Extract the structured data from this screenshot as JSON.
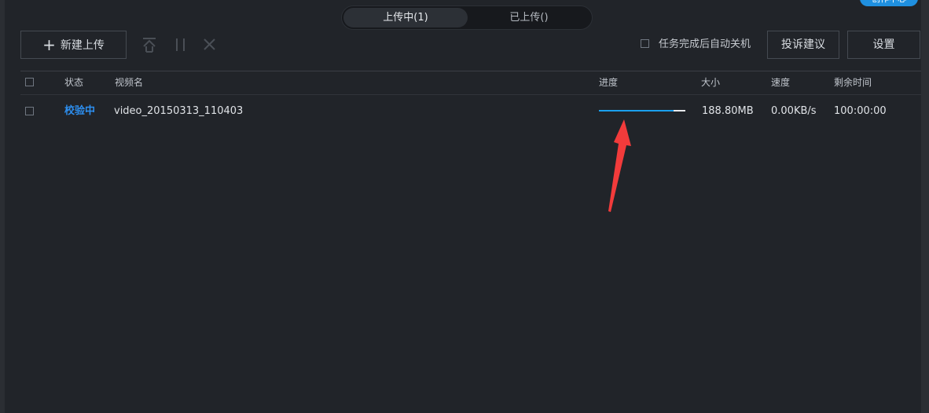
{
  "tabs": [
    {
      "label": "上传中(1)",
      "active": true
    },
    {
      "label": "已上传()",
      "active": false
    }
  ],
  "corner_badge": "创作中心",
  "toolbar": {
    "new_upload_label": "新建上传",
    "auto_shutdown_label": "任务完成后自动关机",
    "complaint_label": "投诉建议",
    "settings_label": "设置",
    "icons": [
      "move-to-top-icon",
      "pause-icon",
      "close-icon"
    ]
  },
  "table": {
    "columns": [
      "状态",
      "视频名",
      "进度",
      "大小",
      "速度",
      "剩余时间"
    ],
    "rows": [
      {
        "status": "校验中",
        "name": "video_20150313_110403",
        "progress": 0.86,
        "size": "188.80MB",
        "speed": "0.00KB/s",
        "remaining": "100:00:00"
      }
    ]
  },
  "colors": {
    "background": "#212429",
    "accent": "#2d8ff0",
    "progress_fill": "#1aa0ee",
    "annotation": "#f23b3b"
  }
}
